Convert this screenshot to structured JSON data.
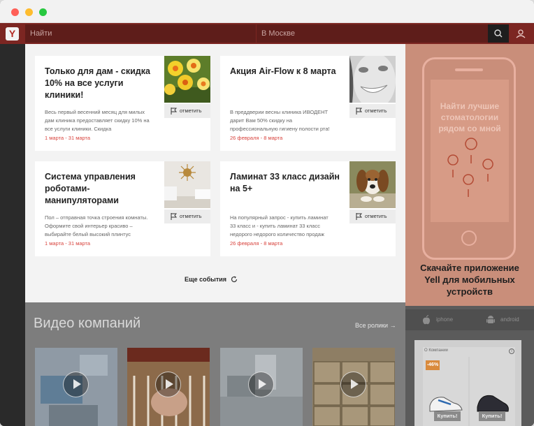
{
  "header": {
    "logo_letter": "Y",
    "search_placeholder": "Найти",
    "location_placeholder": "В Москве"
  },
  "events": [
    {
      "title": "Только для дам - скидка 10% на все услуги клиники!",
      "description": "Весь первый весенний месяц для милых дам клиника предоставляет скидку 10% на все услуги клиники. Скидка распространяется",
      "date": "1 марта - 31 марта",
      "mark_label": "отметить"
    },
    {
      "title": "Акция Air-Flow к 8 марта",
      "description": "В преддверии весны клиника ИВОДЕНТ дарит Вам 50% скидку на профессиональную гигиену полости рта!",
      "date": "26 февраля - 8 марта",
      "mark_label": "отметить"
    },
    {
      "title": "Система управления роботами-манипуляторами",
      "description": "Пол – отправная точка строения комнаты. Оформите свой интерьер красиво – выбирайте белый высокий плинтус",
      "date": "1 марта - 31 марта",
      "mark_label": "отметить"
    },
    {
      "title": "Ламинат 33 класс дизайн на 5+",
      "description": "На популярный запрос - купить ламинат 33 класс и - купить ламинат 33 класс недорого недорого количество продаж",
      "date": "26 февраля - 8 марта",
      "mark_label": "отметить"
    }
  ],
  "more_events_label": "Еще события",
  "videos": {
    "title": "Видео компаний",
    "all_label": "Все ролики →"
  },
  "promo": {
    "phone_text": "Найти лучшие стоматологии рядом со мной",
    "caption": "Скачайте приложение Yell для мобильных устройств",
    "stores": [
      "iphone",
      "android"
    ]
  },
  "ad": {
    "label": "О Компании",
    "info": "i",
    "discount": "-46%",
    "buy_label_1": "Купить!",
    "buy_label_2": "Купить!"
  },
  "colors": {
    "brand": "#b32b25",
    "date": "#d8433d",
    "promo": "#c98e7a"
  }
}
